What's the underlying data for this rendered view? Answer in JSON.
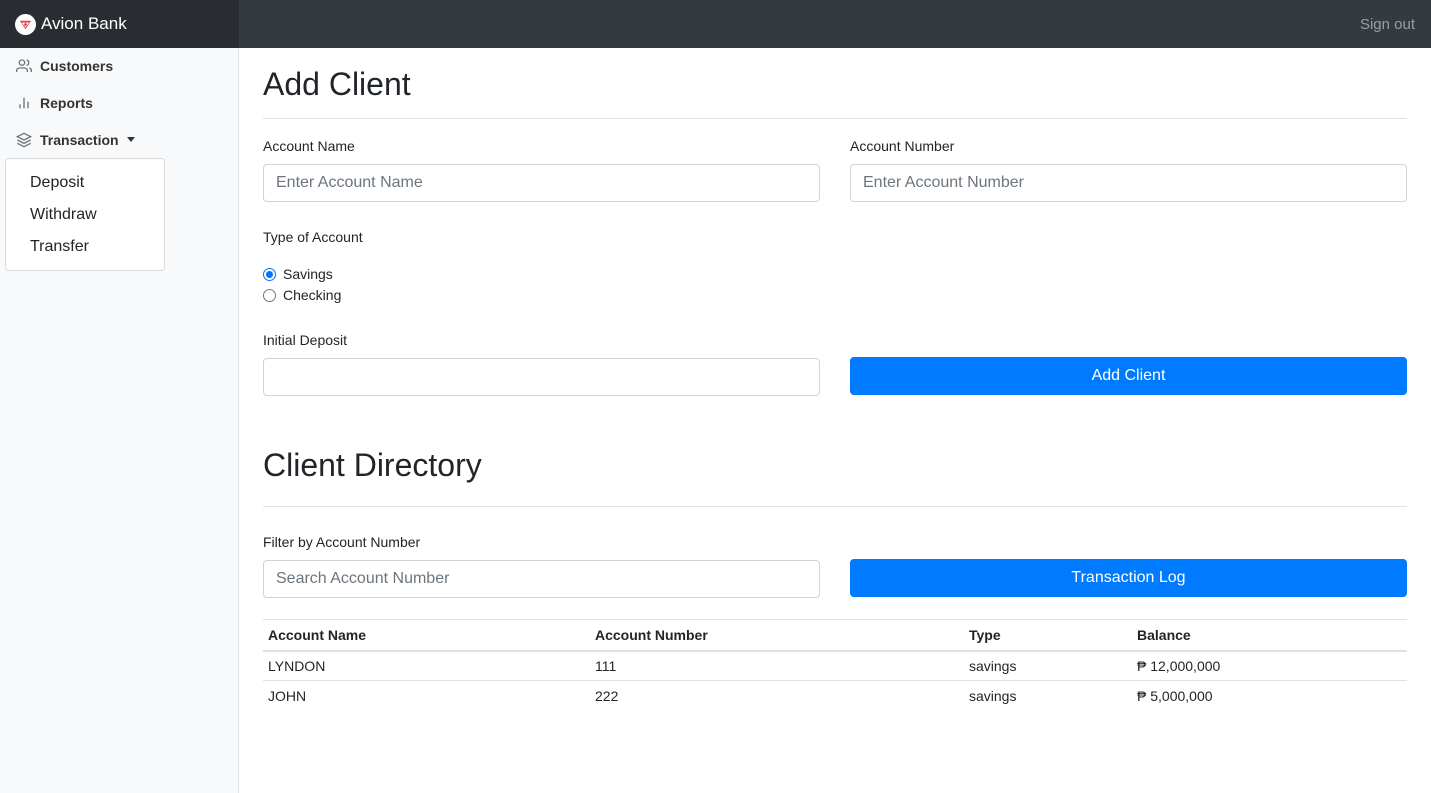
{
  "brand": {
    "name": "Avion Bank"
  },
  "header": {
    "sign_out": "Sign out"
  },
  "sidebar": {
    "items": [
      {
        "label": "Customers",
        "icon": "users-icon"
      },
      {
        "label": "Reports",
        "icon": "bar-chart-icon"
      },
      {
        "label": "Transaction",
        "icon": "layers-icon"
      }
    ],
    "dropdown": [
      "Deposit",
      "Withdraw",
      "Transfer"
    ]
  },
  "add_client": {
    "title": "Add Client",
    "account_name_label": "Account Name",
    "account_name_placeholder": "Enter Account Name",
    "account_number_label": "Account Number",
    "account_number_placeholder": "Enter Account Number",
    "type_label": "Type of Account",
    "types": [
      {
        "label": "Savings",
        "checked": true
      },
      {
        "label": "Checking",
        "checked": false
      }
    ],
    "initial_deposit_label": "Initial Deposit",
    "initial_deposit_value": "",
    "submit_label": "Add Client"
  },
  "directory": {
    "title": "Client Directory",
    "filter_label": "Filter by Account Number",
    "filter_placeholder": "Search Account Number",
    "log_button": "Transaction Log",
    "columns": [
      "Account Name",
      "Account Number",
      "Type",
      "Balance"
    ],
    "rows": [
      [
        "LYNDON",
        "111",
        "savings",
        "₱ 12,000,000"
      ],
      [
        "JOHN",
        "222",
        "savings",
        "₱ 5,000,000"
      ]
    ]
  },
  "colors": {
    "accent": "#007bff",
    "topbar": "#343a40",
    "brand_bg": "#292d32",
    "sidebar": "#f8f9fa"
  }
}
